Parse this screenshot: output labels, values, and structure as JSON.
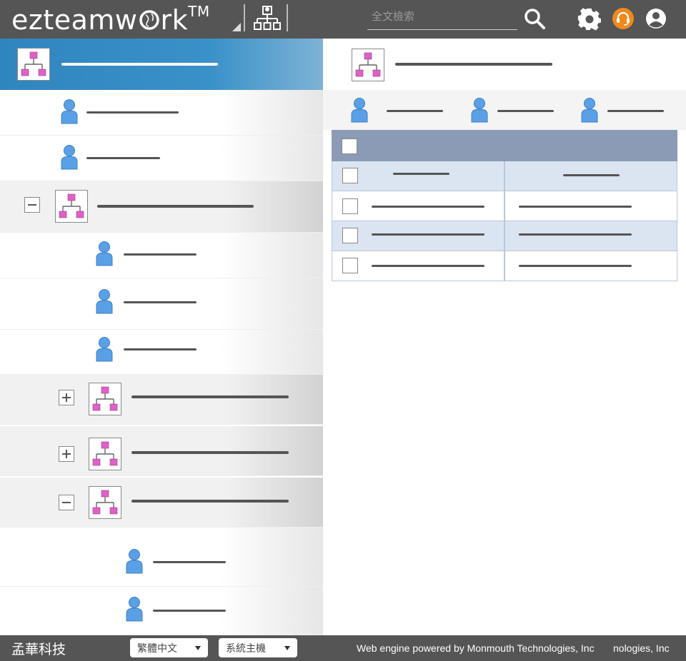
{
  "app": {
    "logo_text": "ezteamw",
    "logo_text_end": "rk",
    "logo_tm": "TM"
  },
  "search": {
    "placeholder": "全文檢索",
    "value": ""
  },
  "colors": {
    "header": "#555555",
    "tree_header": "#3a91c8",
    "person": "#5aa0e6",
    "org_node": "#e060c8",
    "support": "#f08a1c",
    "grid_header": "#8c9bb5",
    "grid_alt_row": "#dbe4f1"
  },
  "icons": {
    "org_chart": "org-chart-icon",
    "search": "search-icon",
    "settings": "gear-icon",
    "support": "headset-icon",
    "account": "user-circle-icon",
    "person": "person-icon",
    "expand": "plus-square-icon",
    "collapse": "minus-square-icon"
  },
  "footer": {
    "brand": "孟華科技",
    "language_selected": "繁體中文",
    "host_selected": "系統主機",
    "powered_by": "Web engine powered by Monmouth Technologies, Inc",
    "powered_by_overflow": "nologies, Inc"
  }
}
